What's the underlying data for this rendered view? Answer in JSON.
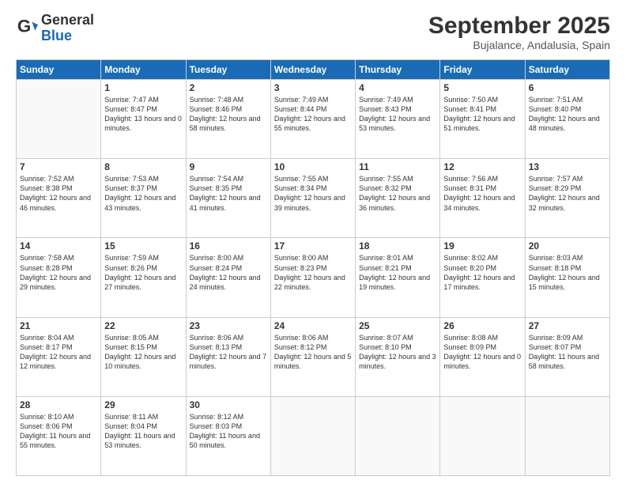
{
  "logo": {
    "line1": "General",
    "line2": "Blue"
  },
  "title": "September 2025",
  "location": "Bujalance, Andalusia, Spain",
  "weekdays": [
    "Sunday",
    "Monday",
    "Tuesday",
    "Wednesday",
    "Thursday",
    "Friday",
    "Saturday"
  ],
  "weeks": [
    [
      {
        "day": null
      },
      {
        "day": "1",
        "sunrise": "7:47 AM",
        "sunset": "8:47 PM",
        "daylight": "13 hours and 0 minutes."
      },
      {
        "day": "2",
        "sunrise": "7:48 AM",
        "sunset": "8:46 PM",
        "daylight": "12 hours and 58 minutes."
      },
      {
        "day": "3",
        "sunrise": "7:49 AM",
        "sunset": "8:44 PM",
        "daylight": "12 hours and 55 minutes."
      },
      {
        "day": "4",
        "sunrise": "7:49 AM",
        "sunset": "8:43 PM",
        "daylight": "12 hours and 53 minutes."
      },
      {
        "day": "5",
        "sunrise": "7:50 AM",
        "sunset": "8:41 PM",
        "daylight": "12 hours and 51 minutes."
      },
      {
        "day": "6",
        "sunrise": "7:51 AM",
        "sunset": "8:40 PM",
        "daylight": "12 hours and 48 minutes."
      }
    ],
    [
      {
        "day": "7",
        "sunrise": "7:52 AM",
        "sunset": "8:38 PM",
        "daylight": "12 hours and 46 minutes."
      },
      {
        "day": "8",
        "sunrise": "7:53 AM",
        "sunset": "8:37 PM",
        "daylight": "12 hours and 43 minutes."
      },
      {
        "day": "9",
        "sunrise": "7:54 AM",
        "sunset": "8:35 PM",
        "daylight": "12 hours and 41 minutes."
      },
      {
        "day": "10",
        "sunrise": "7:55 AM",
        "sunset": "8:34 PM",
        "daylight": "12 hours and 39 minutes."
      },
      {
        "day": "11",
        "sunrise": "7:55 AM",
        "sunset": "8:32 PM",
        "daylight": "12 hours and 36 minutes."
      },
      {
        "day": "12",
        "sunrise": "7:56 AM",
        "sunset": "8:31 PM",
        "daylight": "12 hours and 34 minutes."
      },
      {
        "day": "13",
        "sunrise": "7:57 AM",
        "sunset": "8:29 PM",
        "daylight": "12 hours and 32 minutes."
      }
    ],
    [
      {
        "day": "14",
        "sunrise": "7:58 AM",
        "sunset": "8:28 PM",
        "daylight": "12 hours and 29 minutes."
      },
      {
        "day": "15",
        "sunrise": "7:59 AM",
        "sunset": "8:26 PM",
        "daylight": "12 hours and 27 minutes."
      },
      {
        "day": "16",
        "sunrise": "8:00 AM",
        "sunset": "8:24 PM",
        "daylight": "12 hours and 24 minutes."
      },
      {
        "day": "17",
        "sunrise": "8:00 AM",
        "sunset": "8:23 PM",
        "daylight": "12 hours and 22 minutes."
      },
      {
        "day": "18",
        "sunrise": "8:01 AM",
        "sunset": "8:21 PM",
        "daylight": "12 hours and 19 minutes."
      },
      {
        "day": "19",
        "sunrise": "8:02 AM",
        "sunset": "8:20 PM",
        "daylight": "12 hours and 17 minutes."
      },
      {
        "day": "20",
        "sunrise": "8:03 AM",
        "sunset": "8:18 PM",
        "daylight": "12 hours and 15 minutes."
      }
    ],
    [
      {
        "day": "21",
        "sunrise": "8:04 AM",
        "sunset": "8:17 PM",
        "daylight": "12 hours and 12 minutes."
      },
      {
        "day": "22",
        "sunrise": "8:05 AM",
        "sunset": "8:15 PM",
        "daylight": "12 hours and 10 minutes."
      },
      {
        "day": "23",
        "sunrise": "8:06 AM",
        "sunset": "8:13 PM",
        "daylight": "12 hours and 7 minutes."
      },
      {
        "day": "24",
        "sunrise": "8:06 AM",
        "sunset": "8:12 PM",
        "daylight": "12 hours and 5 minutes."
      },
      {
        "day": "25",
        "sunrise": "8:07 AM",
        "sunset": "8:10 PM",
        "daylight": "12 hours and 3 minutes."
      },
      {
        "day": "26",
        "sunrise": "8:08 AM",
        "sunset": "8:09 PM",
        "daylight": "12 hours and 0 minutes."
      },
      {
        "day": "27",
        "sunrise": "8:09 AM",
        "sunset": "8:07 PM",
        "daylight": "11 hours and 58 minutes."
      }
    ],
    [
      {
        "day": "28",
        "sunrise": "8:10 AM",
        "sunset": "8:06 PM",
        "daylight": "11 hours and 55 minutes."
      },
      {
        "day": "29",
        "sunrise": "8:11 AM",
        "sunset": "8:04 PM",
        "daylight": "11 hours and 53 minutes."
      },
      {
        "day": "30",
        "sunrise": "8:12 AM",
        "sunset": "8:03 PM",
        "daylight": "11 hours and 50 minutes."
      },
      {
        "day": null
      },
      {
        "day": null
      },
      {
        "day": null
      },
      {
        "day": null
      }
    ]
  ]
}
